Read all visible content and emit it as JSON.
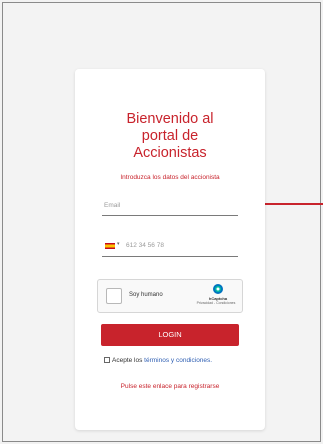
{
  "login": {
    "title": "Bienvenido al\nportal de\nAccionistas",
    "subtitle": "Introduzca los datos del accionista",
    "email_placeholder": "Email",
    "phone_placeholder": "612 34 56 78",
    "captcha": {
      "label": "Soy humano",
      "brand": "hCaptcha",
      "links": "Privacidad - Condiciones"
    },
    "login_button": "LOGIN",
    "terms_prefix": "Acepte los ",
    "terms_link": "términos y condiciones.",
    "register_link": "Pulse este enlace para registrarse"
  },
  "icons": {
    "flag": "spain-flag-icon",
    "captcha_logo": "hcaptcha-logo-icon"
  },
  "colors": {
    "accent": "#c8232c",
    "link": "#2f5fb3",
    "background": "#f2f2f2"
  }
}
